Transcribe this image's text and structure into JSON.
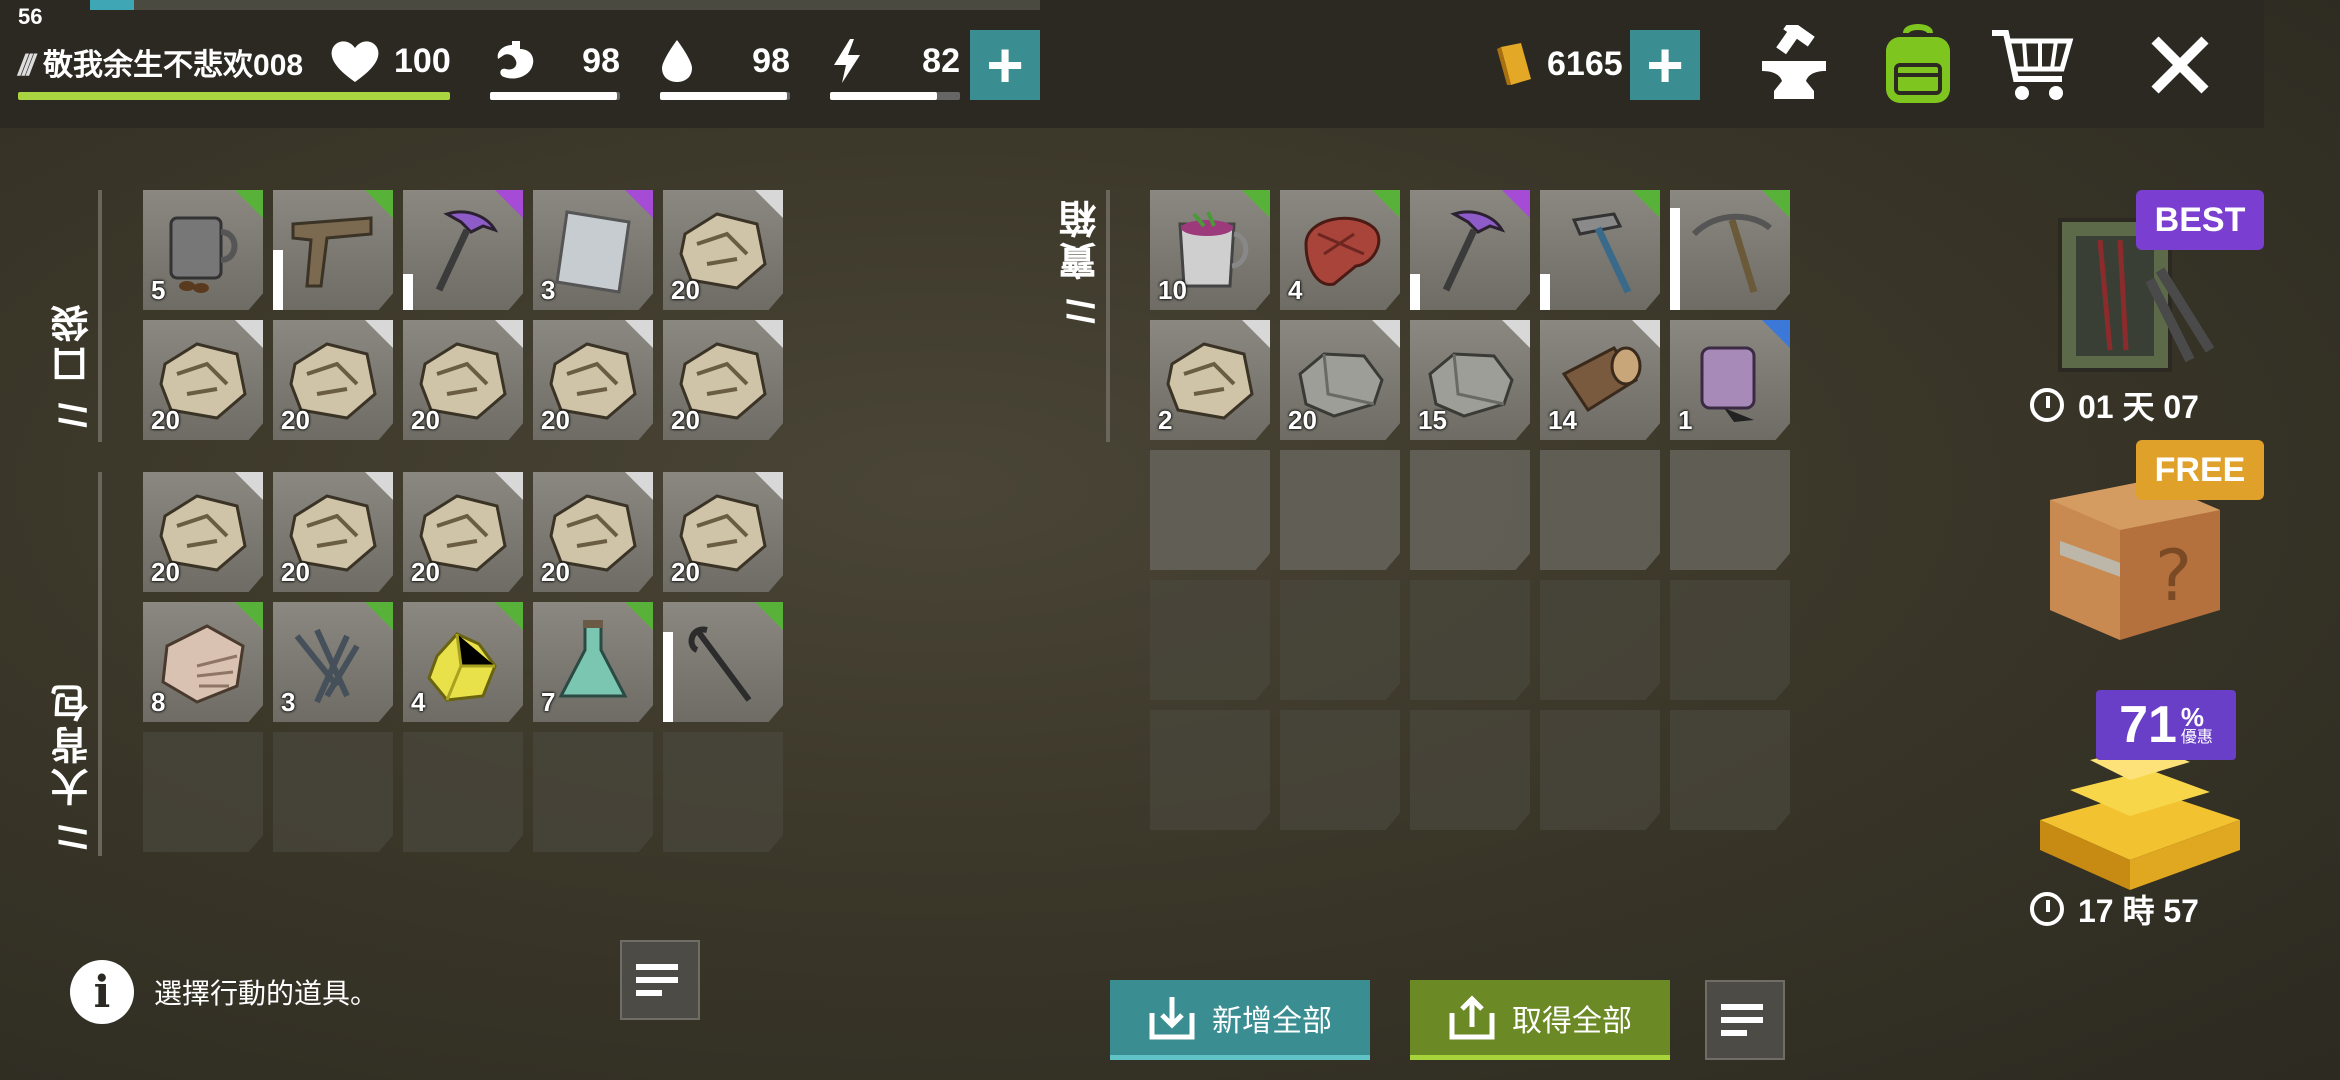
{
  "fps": "56",
  "player": {
    "name": "敬我余生不悲欢008"
  },
  "stats": {
    "health": "100",
    "hunger": "98",
    "thirst": "98",
    "energy": "82",
    "hunger_fill": 0.98,
    "thirst_fill": 0.98,
    "energy_fill": 0.82
  },
  "currency": {
    "gold": "6165"
  },
  "sections": {
    "pocket": "口袋",
    "backpack": "大背包",
    "chest": "寶箱"
  },
  "pocket_items": [
    {
      "icon": "coffee-mug-icon",
      "count": "5",
      "rarity": "green"
    },
    {
      "icon": "pistol-icon",
      "count": "",
      "rarity": "green",
      "durability": 0.5
    },
    {
      "icon": "purple-pickaxe-icon",
      "count": "",
      "rarity": "purple",
      "durability": 0.3
    },
    {
      "icon": "metal-plate-icon",
      "count": "3",
      "rarity": "purple"
    },
    {
      "icon": "stone-icon",
      "count": "20",
      "rarity": "white"
    },
    {
      "icon": "stone-icon",
      "count": "20",
      "rarity": "white"
    },
    {
      "icon": "stone-icon",
      "count": "20",
      "rarity": "white"
    },
    {
      "icon": "stone-icon",
      "count": "20",
      "rarity": "white"
    },
    {
      "icon": "stone-icon",
      "count": "20",
      "rarity": "white"
    },
    {
      "icon": "stone-icon",
      "count": "20",
      "rarity": "white"
    }
  ],
  "backpack_items": [
    {
      "icon": "stone-icon",
      "count": "20",
      "rarity": "white"
    },
    {
      "icon": "stone-icon",
      "count": "20",
      "rarity": "white"
    },
    {
      "icon": "stone-icon",
      "count": "20",
      "rarity": "white"
    },
    {
      "icon": "stone-icon",
      "count": "20",
      "rarity": "white"
    },
    {
      "icon": "stone-icon",
      "count": "20",
      "rarity": "white"
    },
    {
      "icon": "limestone-icon",
      "count": "8",
      "rarity": "green"
    },
    {
      "icon": "nails-icon",
      "count": "3",
      "rarity": "green"
    },
    {
      "icon": "sulfur-icon",
      "count": "4",
      "rarity": "green"
    },
    {
      "icon": "flask-icon",
      "count": "7",
      "rarity": "green"
    },
    {
      "icon": "crowbar-icon",
      "count": "",
      "rarity": "green",
      "durability": 0.75
    }
  ],
  "chest_items": [
    {
      "icon": "berry-juice-icon",
      "count": "10",
      "rarity": "green"
    },
    {
      "icon": "steak-icon",
      "count": "4",
      "rarity": "green"
    },
    {
      "icon": "purple-pickaxe-icon",
      "count": "",
      "rarity": "purple",
      "durability": 0.3
    },
    {
      "icon": "hammer-icon",
      "count": "",
      "rarity": "green",
      "durability": 0.3
    },
    {
      "icon": "pickaxe-icon",
      "count": "",
      "rarity": "green",
      "durability": 0.85
    },
    {
      "icon": "stone-icon",
      "count": "2",
      "rarity": "white"
    },
    {
      "icon": "iron-ore-icon",
      "count": "20",
      "rarity": "white"
    },
    {
      "icon": "iron-ore-icon",
      "count": "15",
      "rarity": "white"
    },
    {
      "icon": "log-icon",
      "count": "14",
      "rarity": "white"
    },
    {
      "icon": "gunpowder-jar-icon",
      "count": "1",
      "rarity": "blue"
    }
  ],
  "info_text": "選擇行動的道具。",
  "buttons": {
    "add_all": "新增全部",
    "take_all": "取得全部"
  },
  "offers": {
    "best_label": "BEST",
    "best_timer": "01 天 07",
    "free_label": "FREE",
    "discount": "71",
    "discount_unit": "%",
    "discount_word": "優惠",
    "gold_timer": "17 時 57"
  },
  "colors": {
    "accent": "#3a8e92",
    "green_btn": "#6b8a25",
    "hp": "#a9d640",
    "purple": "#7a3fd0",
    "gold": "#e0a12a"
  }
}
